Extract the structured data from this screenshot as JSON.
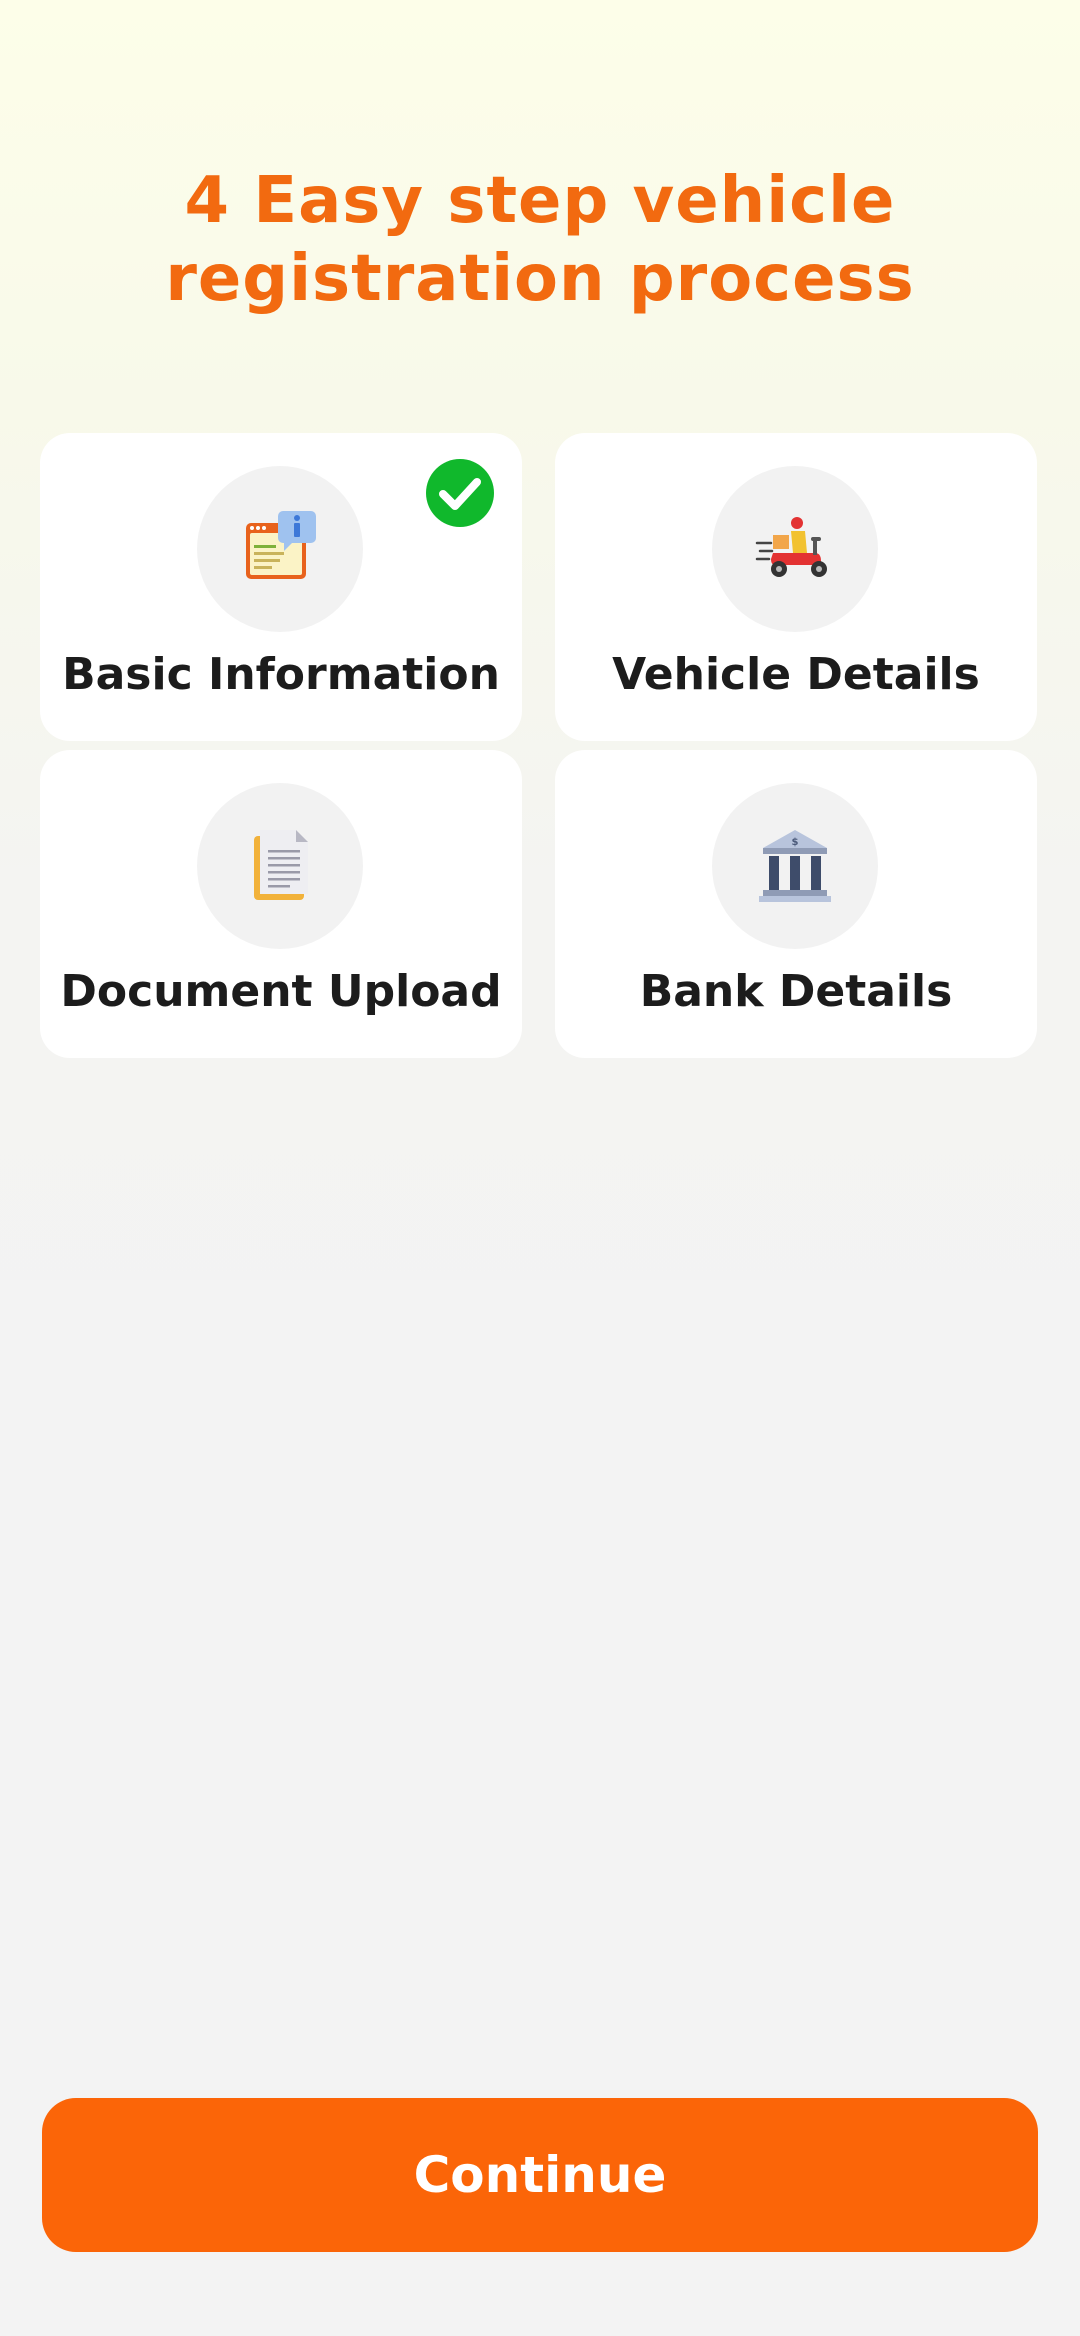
{
  "header": {
    "title_line1": "4 Easy step vehicle",
    "title_line2": "registration process"
  },
  "steps": [
    {
      "label": "Basic Information",
      "icon": "info-document-icon",
      "completed": true
    },
    {
      "label": "Vehicle Details",
      "icon": "scooter-delivery-icon",
      "completed": false
    },
    {
      "label": "Document Upload",
      "icon": "document-icon",
      "completed": false
    },
    {
      "label": "Bank Details",
      "icon": "bank-icon",
      "completed": false
    }
  ],
  "footer": {
    "continue_label": "Continue"
  },
  "colors": {
    "accent": "#f26a10",
    "button": "#fb6508",
    "check": "#10b82c"
  }
}
